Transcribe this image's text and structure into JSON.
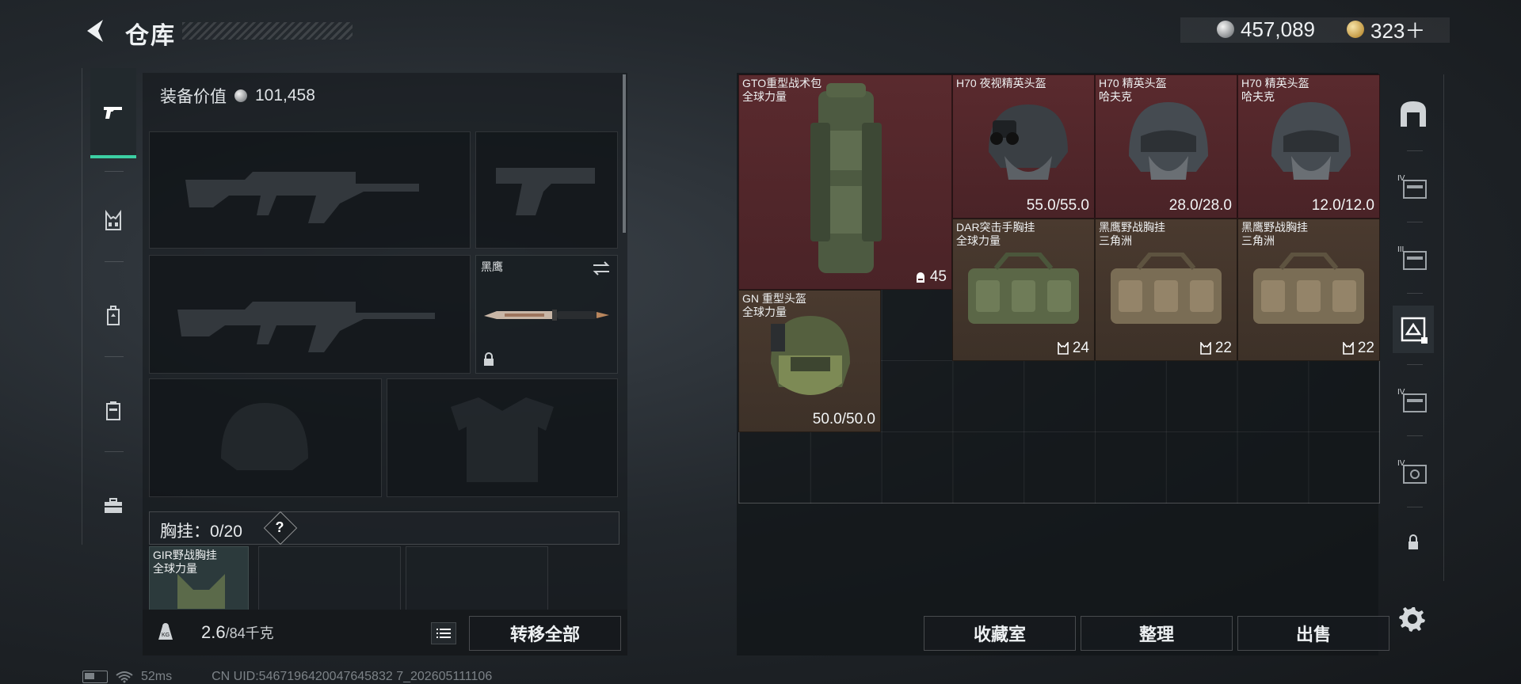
{
  "header": {
    "title": "仓库",
    "currency_silver": "457,089",
    "currency_gold": "323＋"
  },
  "left_tabs": [
    {
      "name": "weapons",
      "icon": "pistol-icon",
      "active": true
    },
    {
      "name": "chest-rig",
      "icon": "chest-rig-icon",
      "active": false
    },
    {
      "name": "backpack",
      "icon": "backpack-icon",
      "active": false
    },
    {
      "name": "container",
      "icon": "container-icon",
      "active": false
    },
    {
      "name": "toolbox",
      "icon": "toolbox-icon",
      "active": false
    }
  ],
  "equipment": {
    "value_label": "装备价值",
    "value": "101,458",
    "melee_label": "黑鹰",
    "chest_label": "胸挂：",
    "chest_count": "0/20",
    "help": "?",
    "chest_items": [
      {
        "name_line1": "GIR野战胸挂",
        "name_line2": "全球力量"
      }
    ]
  },
  "weight": {
    "current": "2.6",
    "max": "/84千克",
    "icon": "kg-weight-icon"
  },
  "buttons": {
    "transfer_all": "转移全部",
    "collection": "收藏室",
    "organize": "整理",
    "sell": "出售"
  },
  "inventory": [
    {
      "line1": "GTO重型战术包",
      "line2": "全球力量",
      "value": "45",
      "value_icon": "capacity-icon",
      "rarity": "red"
    },
    {
      "line1": "H70 夜视精英头盔",
      "line2": "",
      "value": "55.0/55.0",
      "value_icon": "",
      "rarity": "red"
    },
    {
      "line1": "H70 精英头盔",
      "line2": "哈夫克",
      "value": "28.0/28.0",
      "value_icon": "",
      "rarity": "red"
    },
    {
      "line1": "H70 精英头盔",
      "line2": "哈夫克",
      "value": "12.0/12.0",
      "value_icon": "",
      "rarity": "red"
    },
    {
      "line1": "DAR突击手胸挂",
      "line2": "全球力量",
      "value": "24",
      "value_icon": "vest-icon",
      "rarity": "orange"
    },
    {
      "line1": "黑鹰野战胸挂",
      "line2": "三角洲",
      "value": "22",
      "value_icon": "vest-icon",
      "rarity": "orange"
    },
    {
      "line1": "黑鹰野战胸挂",
      "line2": "三角洲",
      "value": "22",
      "value_icon": "vest-icon",
      "rarity": "orange"
    },
    {
      "line1": "GN 重型头盔",
      "line2": "全球力量",
      "value": "50.0/50.0",
      "value_icon": "",
      "rarity": "orange"
    }
  ],
  "right_tabs": [
    {
      "name": "safe-box",
      "icon": "safe-icon",
      "tier": ""
    },
    {
      "name": "storage-iv-a",
      "icon": "storage-icon",
      "tier": "IV"
    },
    {
      "name": "storage-iii",
      "icon": "storage-icon",
      "tier": "III"
    },
    {
      "name": "storage-active",
      "icon": "storage-icon",
      "tier": ""
    },
    {
      "name": "storage-iv-b",
      "icon": "storage-icon",
      "tier": "IV"
    },
    {
      "name": "storage-iv-c",
      "icon": "storage-icon",
      "tier": "IV"
    },
    {
      "name": "locked",
      "icon": "lock-icon",
      "tier": ""
    }
  ],
  "status": {
    "ping": "52ms",
    "uid": "CN UID:5467196420047645832 7_202605111106"
  }
}
